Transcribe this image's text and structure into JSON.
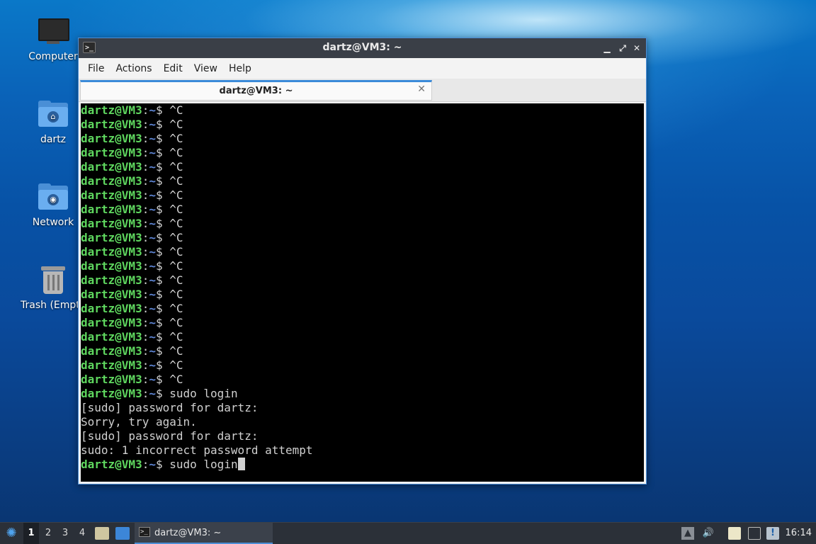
{
  "desktop": {
    "icons": [
      {
        "label": "Computer",
        "icon": "monitor-icon"
      },
      {
        "label": "dartz",
        "icon": "home-folder-icon"
      },
      {
        "label": "Network",
        "icon": "network-folder-icon"
      },
      {
        "label": "Trash (Empt",
        "icon": "trash-icon"
      }
    ]
  },
  "window": {
    "title": "dartz@VM3: ~",
    "controls": {
      "minimize": "▁",
      "maximize": "⤢",
      "close": "✕"
    },
    "menu": [
      "File",
      "Actions",
      "Edit",
      "View",
      "Help"
    ],
    "tab": {
      "title": "dartz@VM3: ~",
      "close": "✕"
    }
  },
  "terminal": {
    "prompt": {
      "user_host": "dartz@VM3",
      "sep": ":",
      "path": "~",
      "symbol": "$ "
    },
    "lines": [
      {
        "type": "prompt",
        "cmd": "^C"
      },
      {
        "type": "prompt",
        "cmd": "^C"
      },
      {
        "type": "prompt",
        "cmd": "^C"
      },
      {
        "type": "prompt",
        "cmd": "^C"
      },
      {
        "type": "prompt",
        "cmd": "^C"
      },
      {
        "type": "prompt",
        "cmd": "^C"
      },
      {
        "type": "prompt",
        "cmd": "^C"
      },
      {
        "type": "prompt",
        "cmd": "^C"
      },
      {
        "type": "prompt",
        "cmd": "^C"
      },
      {
        "type": "prompt",
        "cmd": "^C"
      },
      {
        "type": "prompt",
        "cmd": "^C"
      },
      {
        "type": "prompt",
        "cmd": "^C"
      },
      {
        "type": "prompt",
        "cmd": "^C"
      },
      {
        "type": "prompt",
        "cmd": "^C"
      },
      {
        "type": "prompt",
        "cmd": "^C"
      },
      {
        "type": "prompt",
        "cmd": "^C"
      },
      {
        "type": "prompt",
        "cmd": "^C"
      },
      {
        "type": "prompt",
        "cmd": "^C"
      },
      {
        "type": "prompt",
        "cmd": "^C"
      },
      {
        "type": "prompt",
        "cmd": "^C"
      },
      {
        "type": "prompt",
        "cmd": "sudo login"
      },
      {
        "type": "output",
        "text": "[sudo] password for dartz:"
      },
      {
        "type": "output",
        "text": "Sorry, try again."
      },
      {
        "type": "output",
        "text": "[sudo] password for dartz:"
      },
      {
        "type": "output",
        "text": "sudo: 1 incorrect password attempt"
      },
      {
        "type": "prompt",
        "cmd": "sudo login",
        "cursor": true
      }
    ],
    "colors": {
      "user": "#5fd75f",
      "path": "#5f87d7",
      "text": "#d0d0d0",
      "background": "#000000"
    }
  },
  "taskbar": {
    "workspaces": [
      "1",
      "2",
      "3",
      "4"
    ],
    "active_workspace": "1",
    "task": {
      "label": "dartz@VM3: ~"
    },
    "clock": "16:14",
    "tray": [
      "up-arrow-icon",
      "volume-icon",
      "clipboard-icon",
      "network-icon",
      "update-notifier-icon"
    ]
  }
}
